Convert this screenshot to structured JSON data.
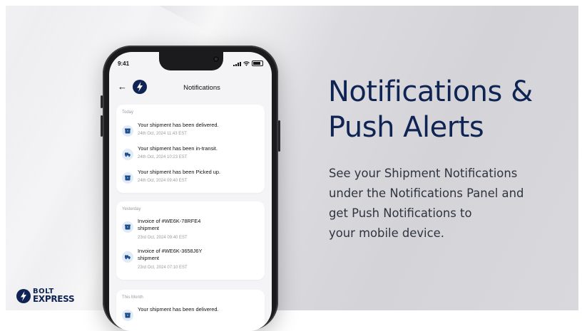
{
  "phone": {
    "status_time": "9:41",
    "nav": {
      "back_icon": "back-arrow-icon",
      "title": "Notifications"
    },
    "groups": [
      {
        "label": "Today",
        "items": [
          {
            "icon": "box-icon",
            "title": "Your shipment has been delivered.",
            "time": "24th Oct, 2024  11:43 EST"
          },
          {
            "icon": "truck-icon",
            "title": "Your shipment has been in-transit.",
            "time": "24th Oct, 2024  10:23 EST"
          },
          {
            "icon": "box-icon",
            "title": "Your shipment has been Picked up.",
            "time": "24th Oct, 2024  09:40 EST"
          }
        ]
      },
      {
        "label": "Yesterday",
        "items": [
          {
            "icon": "box-icon",
            "title": "Invoice of #WE6K-78RFE4 shipment",
            "time": "23rd Oct, 2024  09:40 EST"
          },
          {
            "icon": "truck-icon",
            "title": "Invoice of #WE6K-3658J6Y shipment",
            "time": "23rd Oct, 2024  07:10 EST"
          }
        ]
      },
      {
        "label": "This Month",
        "items": [
          {
            "icon": "box-icon",
            "title": "Your shipment has been delivered.",
            "time": ""
          }
        ]
      }
    ]
  },
  "headline": {
    "line1": "Notifications &",
    "line2": "Push Alerts"
  },
  "description": {
    "line1": "See your Shipment Notifications",
    "line2": "under the Notifications Panel and",
    "line3": "get Push Notifications to",
    "line4": "your mobile device."
  },
  "brand": {
    "line1": "BOLT",
    "line2": "EXPRESS"
  },
  "colors": {
    "navy": "#0f2452",
    "icon_bg": "#e1ebf7",
    "icon_fg": "#1e4e8c"
  }
}
